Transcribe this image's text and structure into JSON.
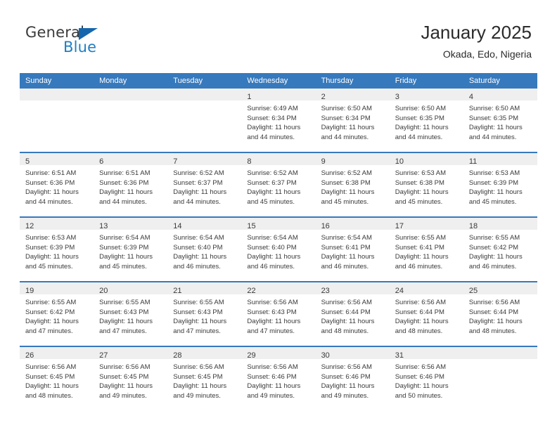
{
  "brand": {
    "name_top": "General",
    "name_bottom": "Blue",
    "accent_color": "#1566ad",
    "blue_text_color": "#1f7fc4"
  },
  "header": {
    "title": "January 2025",
    "subtitle": "Okada, Edo, Nigeria"
  },
  "calendar": {
    "header_bg": "#3679bd",
    "day_header_bg": "#efefef",
    "weekday_labels": [
      "Sunday",
      "Monday",
      "Tuesday",
      "Wednesday",
      "Thursday",
      "Friday",
      "Saturday"
    ],
    "labels": {
      "sunrise": "Sunrise:",
      "sunset": "Sunset:",
      "daylight": "Daylight:"
    },
    "weeks": [
      [
        {
          "day": "",
          "empty": true
        },
        {
          "day": "",
          "empty": true
        },
        {
          "day": "",
          "empty": true
        },
        {
          "day": "1",
          "sunrise": "Sunrise: 6:49 AM",
          "sunset": "Sunset: 6:34 PM",
          "daylight_line1": "Daylight: 11 hours",
          "daylight_line2": "and 44 minutes."
        },
        {
          "day": "2",
          "sunrise": "Sunrise: 6:50 AM",
          "sunset": "Sunset: 6:34 PM",
          "daylight_line1": "Daylight: 11 hours",
          "daylight_line2": "and 44 minutes."
        },
        {
          "day": "3",
          "sunrise": "Sunrise: 6:50 AM",
          "sunset": "Sunset: 6:35 PM",
          "daylight_line1": "Daylight: 11 hours",
          "daylight_line2": "and 44 minutes."
        },
        {
          "day": "4",
          "sunrise": "Sunrise: 6:50 AM",
          "sunset": "Sunset: 6:35 PM",
          "daylight_line1": "Daylight: 11 hours",
          "daylight_line2": "and 44 minutes."
        }
      ],
      [
        {
          "day": "5",
          "sunrise": "Sunrise: 6:51 AM",
          "sunset": "Sunset: 6:36 PM",
          "daylight_line1": "Daylight: 11 hours",
          "daylight_line2": "and 44 minutes."
        },
        {
          "day": "6",
          "sunrise": "Sunrise: 6:51 AM",
          "sunset": "Sunset: 6:36 PM",
          "daylight_line1": "Daylight: 11 hours",
          "daylight_line2": "and 44 minutes."
        },
        {
          "day": "7",
          "sunrise": "Sunrise: 6:52 AM",
          "sunset": "Sunset: 6:37 PM",
          "daylight_line1": "Daylight: 11 hours",
          "daylight_line2": "and 44 minutes."
        },
        {
          "day": "8",
          "sunrise": "Sunrise: 6:52 AM",
          "sunset": "Sunset: 6:37 PM",
          "daylight_line1": "Daylight: 11 hours",
          "daylight_line2": "and 45 minutes."
        },
        {
          "day": "9",
          "sunrise": "Sunrise: 6:52 AM",
          "sunset": "Sunset: 6:38 PM",
          "daylight_line1": "Daylight: 11 hours",
          "daylight_line2": "and 45 minutes."
        },
        {
          "day": "10",
          "sunrise": "Sunrise: 6:53 AM",
          "sunset": "Sunset: 6:38 PM",
          "daylight_line1": "Daylight: 11 hours",
          "daylight_line2": "and 45 minutes."
        },
        {
          "day": "11",
          "sunrise": "Sunrise: 6:53 AM",
          "sunset": "Sunset: 6:39 PM",
          "daylight_line1": "Daylight: 11 hours",
          "daylight_line2": "and 45 minutes."
        }
      ],
      [
        {
          "day": "12",
          "sunrise": "Sunrise: 6:53 AM",
          "sunset": "Sunset: 6:39 PM",
          "daylight_line1": "Daylight: 11 hours",
          "daylight_line2": "and 45 minutes."
        },
        {
          "day": "13",
          "sunrise": "Sunrise: 6:54 AM",
          "sunset": "Sunset: 6:39 PM",
          "daylight_line1": "Daylight: 11 hours",
          "daylight_line2": "and 45 minutes."
        },
        {
          "day": "14",
          "sunrise": "Sunrise: 6:54 AM",
          "sunset": "Sunset: 6:40 PM",
          "daylight_line1": "Daylight: 11 hours",
          "daylight_line2": "and 46 minutes."
        },
        {
          "day": "15",
          "sunrise": "Sunrise: 6:54 AM",
          "sunset": "Sunset: 6:40 PM",
          "daylight_line1": "Daylight: 11 hours",
          "daylight_line2": "and 46 minutes."
        },
        {
          "day": "16",
          "sunrise": "Sunrise: 6:54 AM",
          "sunset": "Sunset: 6:41 PM",
          "daylight_line1": "Daylight: 11 hours",
          "daylight_line2": "and 46 minutes."
        },
        {
          "day": "17",
          "sunrise": "Sunrise: 6:55 AM",
          "sunset": "Sunset: 6:41 PM",
          "daylight_line1": "Daylight: 11 hours",
          "daylight_line2": "and 46 minutes."
        },
        {
          "day": "18",
          "sunrise": "Sunrise: 6:55 AM",
          "sunset": "Sunset: 6:42 PM",
          "daylight_line1": "Daylight: 11 hours",
          "daylight_line2": "and 46 minutes."
        }
      ],
      [
        {
          "day": "19",
          "sunrise": "Sunrise: 6:55 AM",
          "sunset": "Sunset: 6:42 PM",
          "daylight_line1": "Daylight: 11 hours",
          "daylight_line2": "and 47 minutes."
        },
        {
          "day": "20",
          "sunrise": "Sunrise: 6:55 AM",
          "sunset": "Sunset: 6:43 PM",
          "daylight_line1": "Daylight: 11 hours",
          "daylight_line2": "and 47 minutes."
        },
        {
          "day": "21",
          "sunrise": "Sunrise: 6:55 AM",
          "sunset": "Sunset: 6:43 PM",
          "daylight_line1": "Daylight: 11 hours",
          "daylight_line2": "and 47 minutes."
        },
        {
          "day": "22",
          "sunrise": "Sunrise: 6:56 AM",
          "sunset": "Sunset: 6:43 PM",
          "daylight_line1": "Daylight: 11 hours",
          "daylight_line2": "and 47 minutes."
        },
        {
          "day": "23",
          "sunrise": "Sunrise: 6:56 AM",
          "sunset": "Sunset: 6:44 PM",
          "daylight_line1": "Daylight: 11 hours",
          "daylight_line2": "and 48 minutes."
        },
        {
          "day": "24",
          "sunrise": "Sunrise: 6:56 AM",
          "sunset": "Sunset: 6:44 PM",
          "daylight_line1": "Daylight: 11 hours",
          "daylight_line2": "and 48 minutes."
        },
        {
          "day": "25",
          "sunrise": "Sunrise: 6:56 AM",
          "sunset": "Sunset: 6:44 PM",
          "daylight_line1": "Daylight: 11 hours",
          "daylight_line2": "and 48 minutes."
        }
      ],
      [
        {
          "day": "26",
          "sunrise": "Sunrise: 6:56 AM",
          "sunset": "Sunset: 6:45 PM",
          "daylight_line1": "Daylight: 11 hours",
          "daylight_line2": "and 48 minutes."
        },
        {
          "day": "27",
          "sunrise": "Sunrise: 6:56 AM",
          "sunset": "Sunset: 6:45 PM",
          "daylight_line1": "Daylight: 11 hours",
          "daylight_line2": "and 49 minutes."
        },
        {
          "day": "28",
          "sunrise": "Sunrise: 6:56 AM",
          "sunset": "Sunset: 6:45 PM",
          "daylight_line1": "Daylight: 11 hours",
          "daylight_line2": "and 49 minutes."
        },
        {
          "day": "29",
          "sunrise": "Sunrise: 6:56 AM",
          "sunset": "Sunset: 6:46 PM",
          "daylight_line1": "Daylight: 11 hours",
          "daylight_line2": "and 49 minutes."
        },
        {
          "day": "30",
          "sunrise": "Sunrise: 6:56 AM",
          "sunset": "Sunset: 6:46 PM",
          "daylight_line1": "Daylight: 11 hours",
          "daylight_line2": "and 49 minutes."
        },
        {
          "day": "31",
          "sunrise": "Sunrise: 6:56 AM",
          "sunset": "Sunset: 6:46 PM",
          "daylight_line1": "Daylight: 11 hours",
          "daylight_line2": "and 50 minutes."
        },
        {
          "day": "",
          "empty": true
        }
      ]
    ]
  }
}
